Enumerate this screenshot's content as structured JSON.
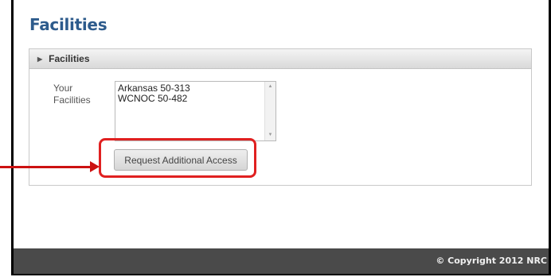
{
  "page": {
    "title": "Facilities"
  },
  "panel": {
    "header_label": "Facilities",
    "caret_icon": "caret-right-icon"
  },
  "facilities_field": {
    "label": "Your Facilities",
    "items": [
      "Arkansas 50-313",
      "WCNOC 50-482"
    ]
  },
  "actions": {
    "request_access_label": "Request Additional Access"
  },
  "annotation": {
    "color": "#e02020"
  },
  "footer": {
    "copyright": "© Copyright 2012 NRC"
  },
  "colors": {
    "title": "#2d5b8c",
    "footer_bg": "#4a4a4a"
  }
}
